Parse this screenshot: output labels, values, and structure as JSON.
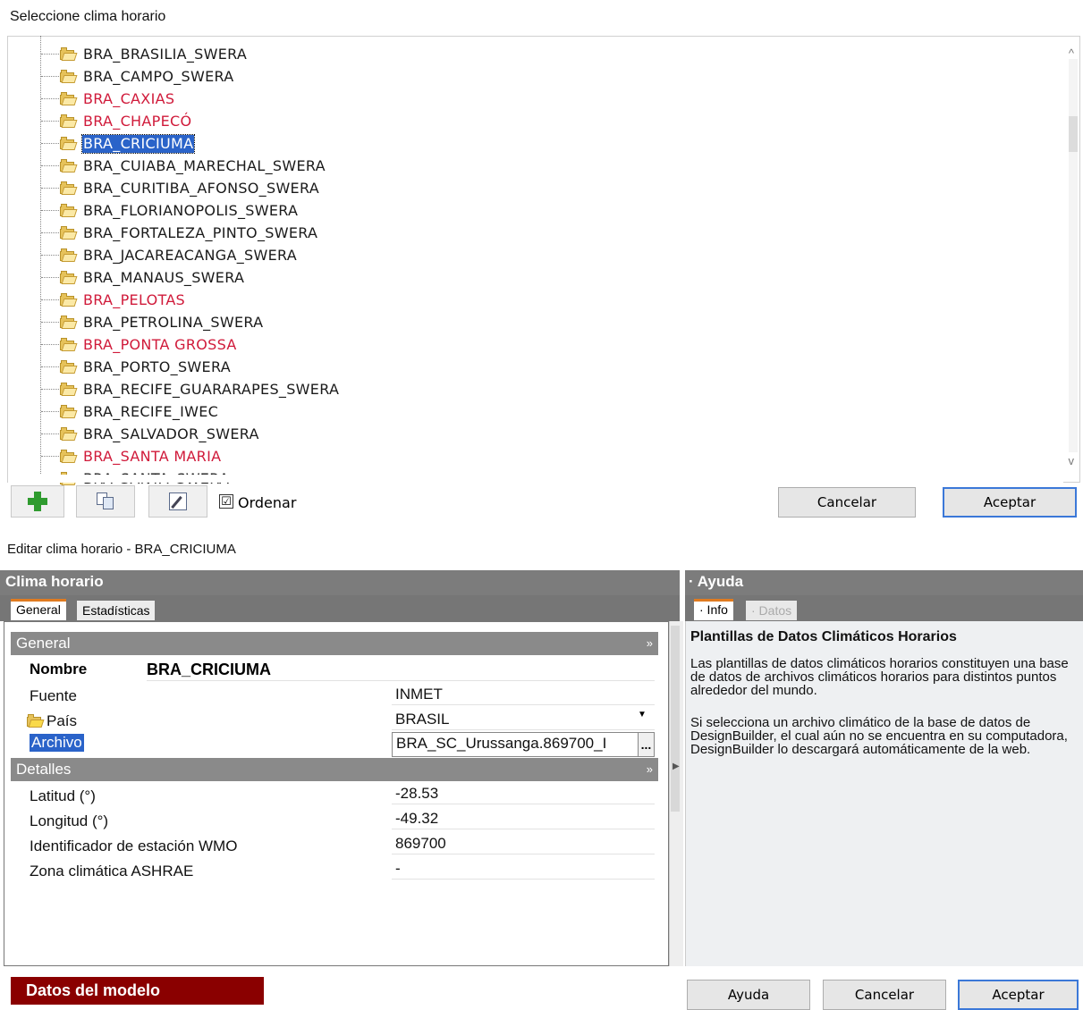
{
  "top_dialog": {
    "title": "Seleccione clima horario",
    "items": [
      {
        "label": "BRA_BRASILIA_SWERA",
        "red": false,
        "selected": false
      },
      {
        "label": "BRA_CAMPO_SWERA",
        "red": false,
        "selected": false
      },
      {
        "label": "BRA_CAXIAS",
        "red": true,
        "selected": false
      },
      {
        "label": "BRA_CHAPECÓ",
        "red": true,
        "selected": false
      },
      {
        "label": "BRA_CRICIUMA",
        "red": false,
        "selected": true
      },
      {
        "label": "BRA_CUIABA_MARECHAL_SWERA",
        "red": false,
        "selected": false
      },
      {
        "label": "BRA_CURITIBA_AFONSO_SWERA",
        "red": false,
        "selected": false
      },
      {
        "label": "BRA_FLORIANOPOLIS_SWERA",
        "red": false,
        "selected": false
      },
      {
        "label": "BRA_FORTALEZA_PINTO_SWERA",
        "red": false,
        "selected": false
      },
      {
        "label": "BRA_JACAREACANGA_SWERA",
        "red": false,
        "selected": false
      },
      {
        "label": "BRA_MANAUS_SWERA",
        "red": false,
        "selected": false
      },
      {
        "label": "BRA_PELOTAS",
        "red": true,
        "selected": false
      },
      {
        "label": "BRA_PETROLINA_SWERA",
        "red": false,
        "selected": false
      },
      {
        "label": "BRA_PONTA GROSSA",
        "red": true,
        "selected": false
      },
      {
        "label": "BRA_PORTO_SWERA",
        "red": false,
        "selected": false
      },
      {
        "label": "BRA_RECIFE_GUARARAPES_SWERA",
        "red": false,
        "selected": false
      },
      {
        "label": "BRA_RECIFE_IWEC",
        "red": false,
        "selected": false
      },
      {
        "label": "BRA_SALVADOR_SWERA",
        "red": false,
        "selected": false
      },
      {
        "label": "BRA_SANTA MARIA",
        "red": true,
        "selected": false
      },
      {
        "label": "BRA_SANTA_SWERA",
        "red": false,
        "selected": false
      }
    ],
    "ordenar_label": "Ordenar",
    "ordenar_checked": "☑",
    "cancel_label": "Cancelar",
    "accept_label": "Aceptar"
  },
  "bottom_dialog": {
    "title": "Editar clima horario - BRA_CRICIUMA",
    "left_header": "Clima horario",
    "right_header": "· Ayuda",
    "tabs": {
      "general": "General",
      "stats": "Estadísticas"
    },
    "help_tabs": {
      "info": "· Info",
      "data": "· Datos"
    },
    "sections": {
      "general": "General",
      "details": "Detalles",
      "chevron": "»"
    },
    "fields": {
      "nombre_label": "Nombre",
      "nombre_value": "BRA_CRICIUMA",
      "fuente_label": "Fuente",
      "fuente_value": "INMET",
      "pais_label": "País",
      "pais_value": "BRASIL",
      "archivo_label": "Archivo",
      "archivo_value": "BRA_SC_Urussanga.869700_I",
      "archivo_btn": "...",
      "latitud_label": "Latitud (°)",
      "latitud_value": "-28.53",
      "longitud_label": "Longitud (°)",
      "longitud_value": "-49.32",
      "wmo_label": "Identificador de estación WMO",
      "wmo_value": "869700",
      "ashrae_label": "Zona climática ASHRAE",
      "ashrae_value": "-"
    },
    "help": {
      "title": "Plantillas de Datos Climáticos Horarios",
      "p1": "Las plantillas de datos climáticos horarios constituyen una base de datos de archivos climáticos horarios para distintos puntos alrededor del mundo.",
      "p2": "Si selecciona un archivo climático de la base de datos de DesignBuilder, el cual aún no se encuentra en su computadora, DesignBuilder lo descargará automáticamente de la web."
    },
    "model_data_label": "Datos del modelo",
    "help_button": "Ayuda",
    "cancel_button": "Cancelar",
    "accept_button": "Aceptar"
  },
  "colors": {
    "accent_blue": "#2a63c9",
    "red_item": "#d01a3a",
    "model_bar": "#8a0000",
    "tab_orange": "#e07b20"
  }
}
